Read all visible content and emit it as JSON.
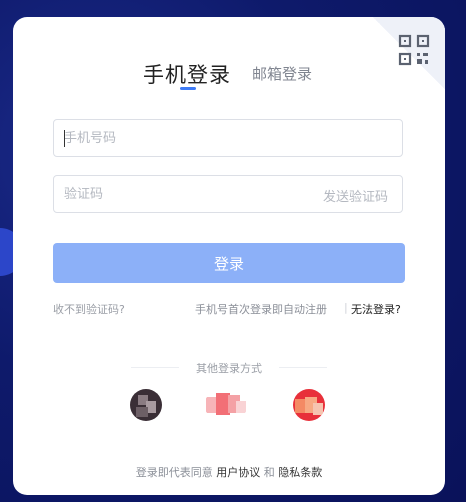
{
  "tabs": {
    "active": "手机登录",
    "other": "邮箱登录"
  },
  "form": {
    "phone_placeholder": "手机号码",
    "code_placeholder": "验证码",
    "send_code": "发送验证码",
    "login_button": "登录"
  },
  "links": {
    "no_code": "收不到验证码?",
    "auto_register": "手机号首次登录即自动注册",
    "separator": "|",
    "cant_login": "无法登录?"
  },
  "other_login": {
    "title": "其他登录方式"
  },
  "footer": {
    "prefix": "登录即代表同意",
    "user_agreement": "用户协议",
    "and": "和",
    "privacy": "隐私条款"
  },
  "colors": {
    "accent": "#3e7bf6",
    "button": "#8cb0f8",
    "background": "#0e1a6b"
  },
  "icons": {
    "qr": "qr-code-icon"
  }
}
